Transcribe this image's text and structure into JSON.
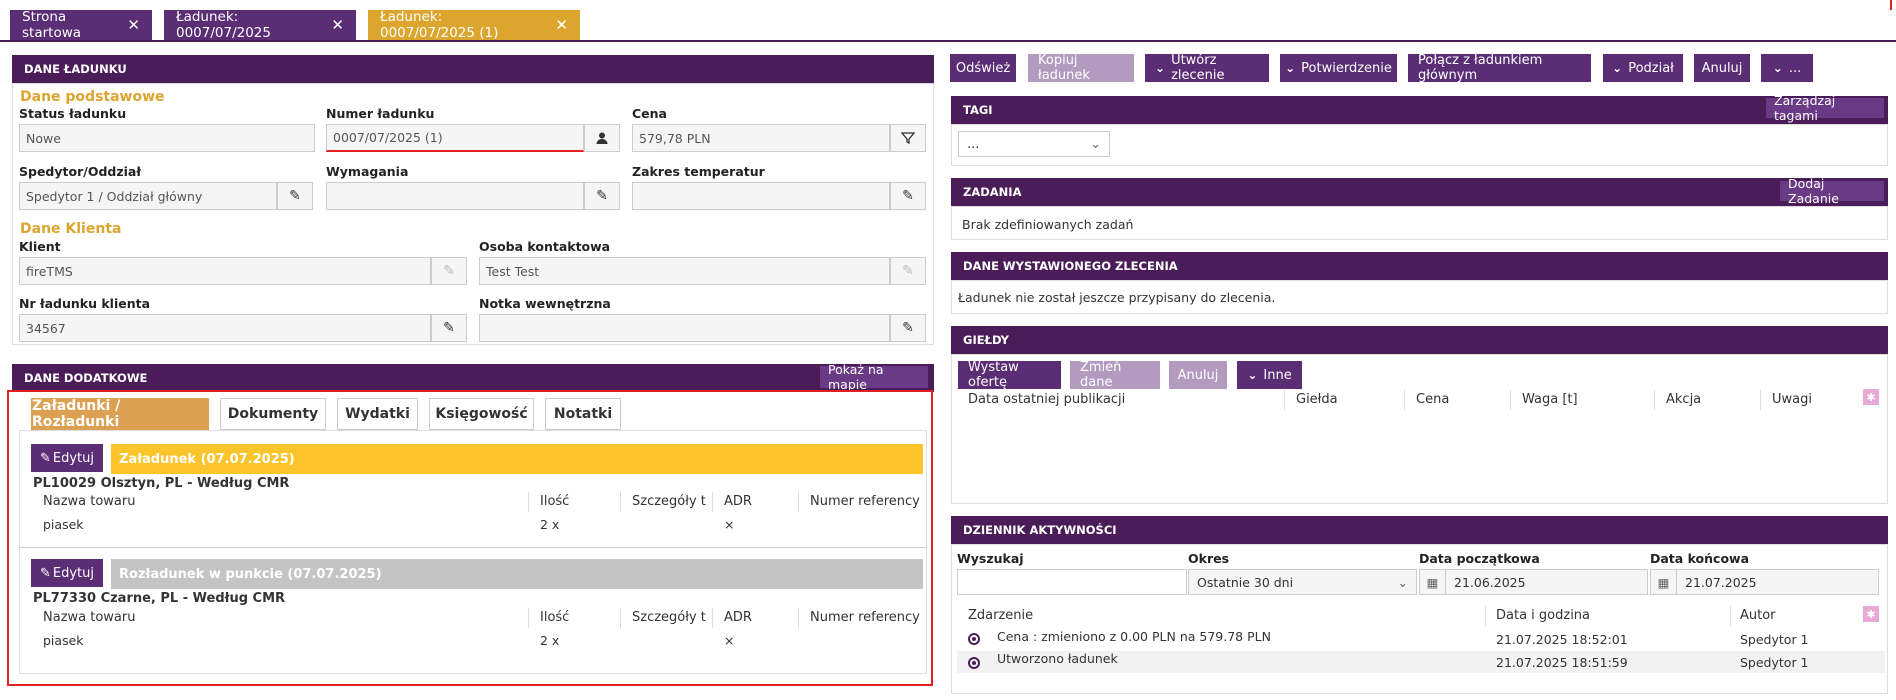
{
  "tabs": [
    {
      "label": "Strona startowa"
    },
    {
      "label": "Ładunek: 0007/07/2025"
    },
    {
      "label": "Ładunek: 0007/07/2025 (1)"
    }
  ],
  "left": {
    "header": "DANE ŁADUNKU",
    "basic_section": "Dane podstawowe",
    "status_label": "Status ładunku",
    "status_value": "Nowe",
    "number_label": "Numer ładunku",
    "number_value": "0007/07/2025 (1)",
    "price_label": "Cena",
    "price_value": "579,78 PLN",
    "forwarder_label": "Spedytor/Oddział",
    "forwarder_value": "Spedytor 1 / Oddział główny",
    "requirements_label": "Wymagania",
    "requirements_value": "",
    "temp_label": "Zakres temperatur",
    "temp_value": "",
    "client_section": "Dane Klienta",
    "client_label": "Klient",
    "client_value": "fireTMS",
    "contact_label": "Osoba kontaktowa",
    "contact_value": "Test Test",
    "client_no_label": "Nr ładunku klienta",
    "client_no_value": "34567",
    "note_label": "Notka wewnętrzna",
    "note_value": ""
  },
  "extra": {
    "header": "DANE DODATKOWE",
    "map_button": "Pokaż na mapie",
    "tabs": [
      "Załadunki / Rozładunki",
      "Dokumenty",
      "Wydatki",
      "Księgowość",
      "Notatki"
    ],
    "edit_label": "Edytuj",
    "columns": [
      "Nazwa towaru",
      "Ilość",
      "Szczegóły tow",
      "ADR",
      "Numer referency"
    ],
    "stops": [
      {
        "title": "Załadunek (07.07.2025)",
        "address": "PL10029 Olsztyn, PL - Według CMR",
        "goods": "piasek",
        "qty": "2 x",
        "adr": "×"
      },
      {
        "title": "Rozładunek w punkcie (07.07.2025)",
        "address": "PL77330 Czarne, PL - Według CMR",
        "goods": "piasek",
        "qty": "2 x",
        "adr": "×"
      }
    ]
  },
  "toolbar": {
    "refresh": "Odśwież",
    "copy": "Kopiuj ładunek",
    "create_order": "Utwórz zlecenie",
    "confirm": "Potwierdzenie",
    "merge": "Połącz z ładunkiem głównym",
    "split": "Podział",
    "cancel": "Anuluj",
    "more": "..."
  },
  "tags": {
    "header": "TAGI",
    "manage": "Zarządzaj tagami",
    "select_value": "..."
  },
  "tasks": {
    "header": "ZADANIA",
    "add": "Dodaj Zadanie",
    "empty": "Brak zdefiniowanych zadań"
  },
  "order": {
    "header": "DANE WYSTAWIONEGO ZLECENIA",
    "text": "Ładunek nie został jeszcze przypisany do zlecenia."
  },
  "exchanges": {
    "header": "GIEŁDY",
    "publish": "Wystaw ofertę",
    "change": "Zmień dane",
    "cancel": "Anuluj",
    "other": "Inne",
    "columns": [
      "Data ostatniej publikacji",
      "Giełda",
      "Cena",
      "Waga [t]",
      "Akcja",
      "Uwagi"
    ]
  },
  "activity": {
    "header": "DZIENNIK AKTYWNOŚCI",
    "search_label": "Wyszukaj",
    "period_label": "Okres",
    "period_value": "Ostatnie 30 dni",
    "start_label": "Data początkowa",
    "start_value": "21.06.2025",
    "end_label": "Data końcowa",
    "end_value": "21.07.2025",
    "columns": [
      "Zdarzenie",
      "Data i godzina",
      "Autor"
    ],
    "rows": [
      {
        "event": "Cena : zmieniono z 0.00 PLN na 579.78 PLN",
        "date": "21.07.2025 18:52:01",
        "author": "Spedytor 1"
      },
      {
        "event": "Utworzono ładunek",
        "date": "21.07.2025 18:51:59",
        "author": "Spedytor 1"
      }
    ]
  },
  "colors": {
    "primary": "#5b2d74",
    "header": "#4a1c58",
    "accent": "#dca52e",
    "highlight": "#e02020"
  }
}
